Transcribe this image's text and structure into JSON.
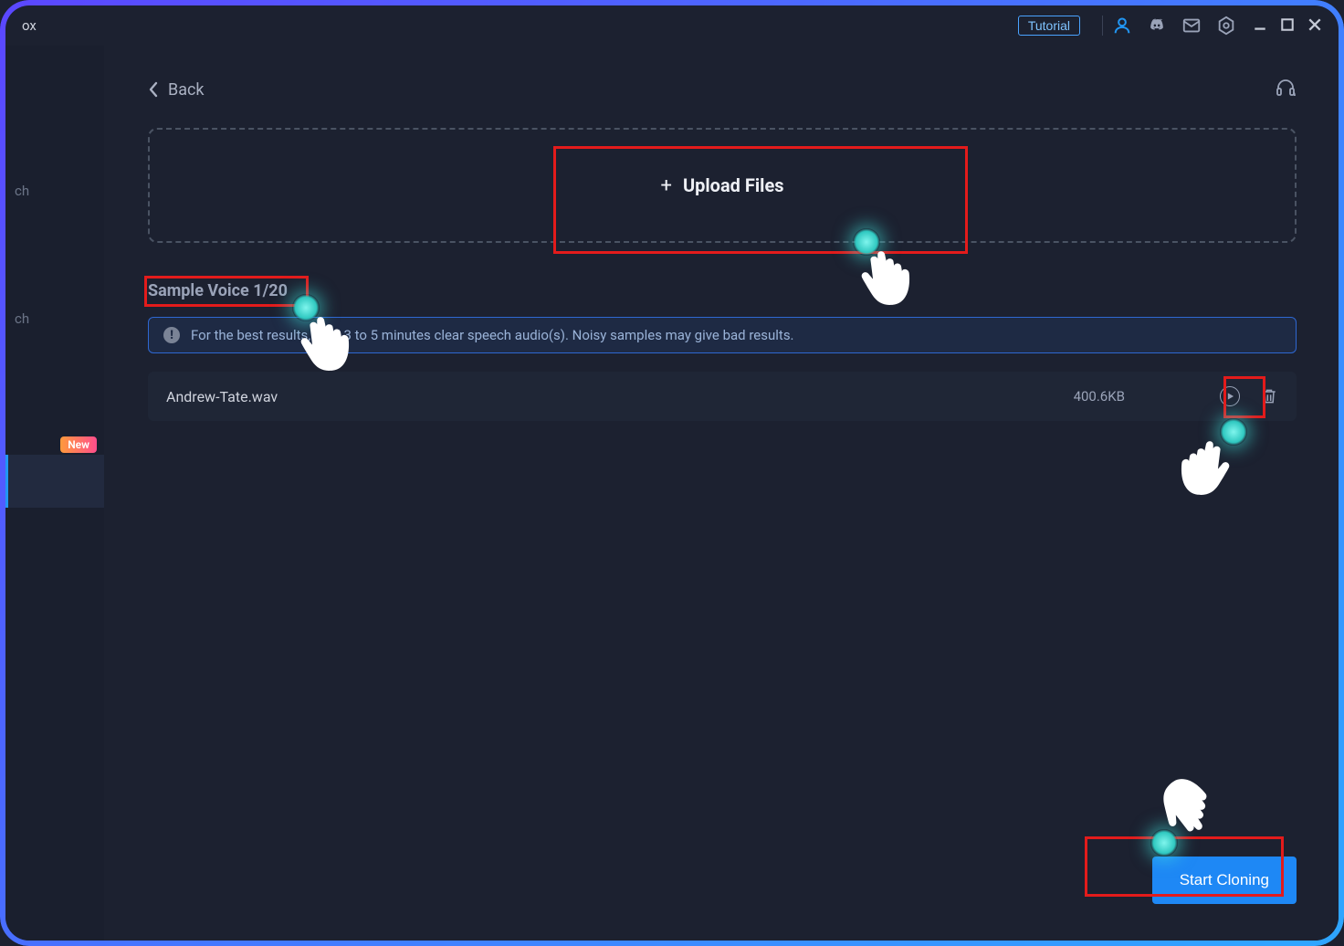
{
  "app": {
    "title_fragment": "ox"
  },
  "titlebar": {
    "tutorial_label": "Tutorial",
    "icons": {
      "user": "user-icon",
      "discord": "discord-icon",
      "mail": "mail-icon",
      "settings": "settings-hex-icon"
    }
  },
  "sidebar": {
    "items": [
      {
        "label_fragment": "ch"
      },
      {
        "label_fragment": "ch"
      },
      {
        "label_fragment": "",
        "active": true,
        "badge": "New"
      }
    ]
  },
  "back_label": "Back",
  "upload": {
    "label": "Upload Files",
    "plus": "+"
  },
  "section_title": "Sample Voice 1/20",
  "info_text": "For the best results, p             ad 3 to 5 minutes clear speech audio(s). Noisy samples may give bad results.",
  "files": [
    {
      "name": "Andrew-Tate.wav",
      "size": "400.6KB"
    }
  ],
  "cta_label": "Start Cloning",
  "colors": {
    "accent": "#2196f3",
    "highlight": "#e31b1b",
    "glow": "#42e8e0"
  }
}
